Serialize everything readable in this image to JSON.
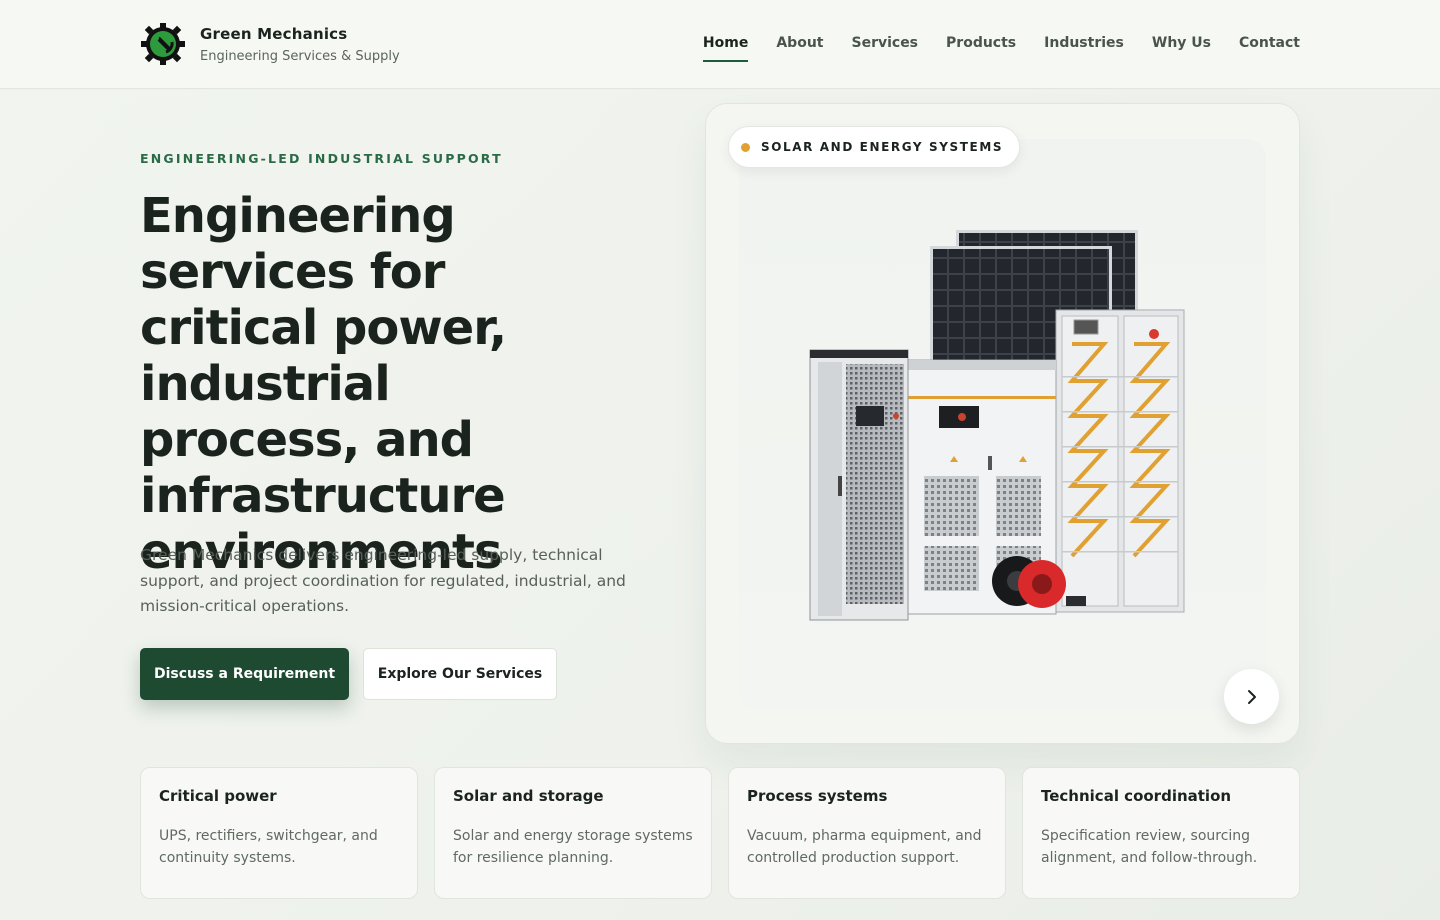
{
  "brand": {
    "name": "Green Mechanics",
    "tagline": "Engineering Services & Supply",
    "logo_icon": "gear-wrench-logo",
    "accent_color": "#1e4a31",
    "highlight_color": "#e0a132"
  },
  "nav": {
    "items": [
      {
        "label": "Home",
        "active": true
      },
      {
        "label": "About"
      },
      {
        "label": "Services"
      },
      {
        "label": "Products"
      },
      {
        "label": "Industries"
      },
      {
        "label": "Why Us"
      },
      {
        "label": "Contact"
      }
    ]
  },
  "hero": {
    "eyebrow": "ENGINEERING-LED INDUSTRIAL SUPPORT",
    "headline": "Engineering services for critical power, industrial process, and infrastructure environments",
    "lead": "Green Mechanics delivers engineering-led supply, technical support, and project coordination for regulated, industrial, and mission-critical operations.",
    "primary_button": "Discuss a Requirement",
    "secondary_button": "Explore Our Services"
  },
  "showcase": {
    "tag": "SOLAR AND ENERGY SYSTEMS",
    "next_icon": "chevron-right-icon"
  },
  "features": [
    {
      "title": "Critical power",
      "description": "UPS, rectifiers, switchgear, and continuity systems."
    },
    {
      "title": "Solar and storage",
      "description": "Solar and energy storage systems for resilience planning."
    },
    {
      "title": "Process systems",
      "description": "Vacuum, pharma equipment, and controlled production support."
    },
    {
      "title": "Technical coordination",
      "description": "Specification review, sourcing alignment, and follow-through."
    }
  ]
}
